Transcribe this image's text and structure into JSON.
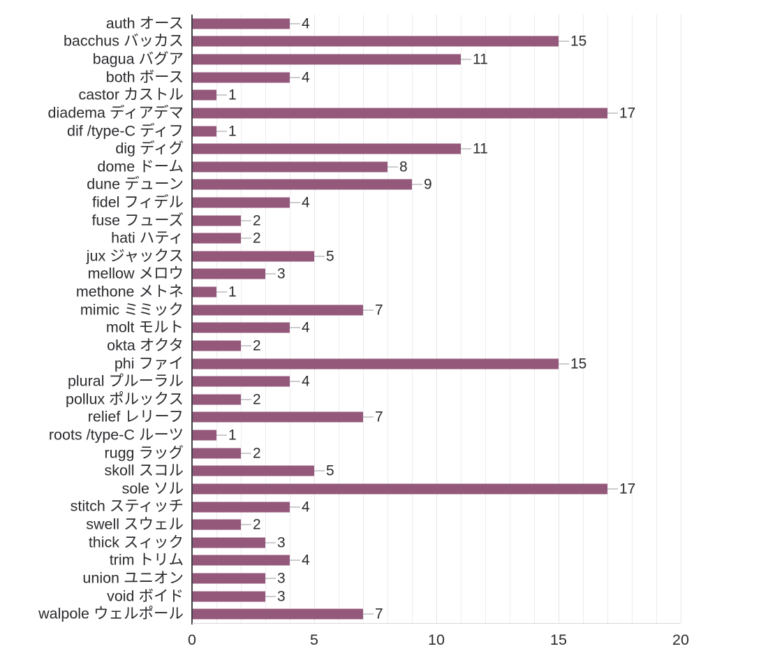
{
  "chart_data": {
    "type": "bar",
    "orientation": "horizontal",
    "title": "",
    "subtitle": "",
    "xlabel": "",
    "ylabel": "",
    "xlim": [
      0,
      20
    ],
    "xticks": [
      0,
      5,
      10,
      15,
      20
    ],
    "xtick_labels": [
      "0",
      "5",
      "10",
      "15",
      "20"
    ],
    "grid": true,
    "grid_axis": "x",
    "legend": null,
    "bar_color": "#94587b",
    "value_labels_shown": true,
    "categories": [
      "auth オース",
      "bacchus バッカス",
      "bagua バグア",
      "both ボース",
      "castor カストル",
      "diadema ディアデマ",
      "dif /type-C ディフ",
      "dig ディグ",
      "dome ドーム",
      "dune デューン",
      "fidel フィデル",
      "fuse フューズ",
      "hati ハティ",
      "jux ジャックス",
      "mellow メロウ",
      "methone メトネ",
      "mimic ミミック",
      "molt モルト",
      "okta オクタ",
      "phi ファイ",
      "plural プルーラル",
      "pollux ポルックス",
      "relief レリーフ",
      "roots /type-C ルーツ",
      "rugg ラッグ",
      "skoll スコル",
      "sole ソル",
      "stitch スティッチ",
      "swell スウェル",
      "thick スィック",
      "trim トリム",
      "union ユニオン",
      "void ボイド",
      "walpole ウェルポール"
    ],
    "values": [
      4,
      15,
      11,
      4,
      1,
      17,
      1,
      11,
      8,
      9,
      4,
      2,
      2,
      5,
      3,
      1,
      7,
      4,
      2,
      15,
      4,
      2,
      7,
      1,
      2,
      5,
      17,
      4,
      2,
      3,
      4,
      3,
      3,
      7
    ]
  }
}
